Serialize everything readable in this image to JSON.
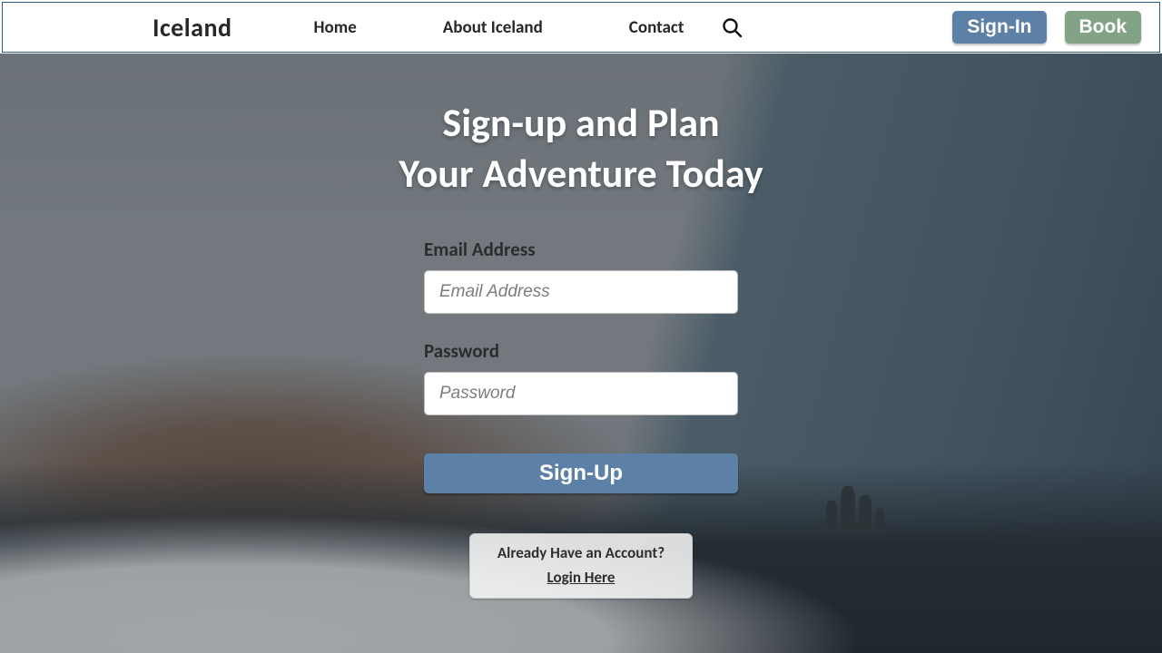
{
  "brand": "Iceland",
  "nav": {
    "home": "Home",
    "about": "About Iceland",
    "contact": "Contact"
  },
  "buttons": {
    "signin": "Sign-In",
    "book": "Book",
    "signup": "Sign-Up"
  },
  "headline_line1": "Sign-up and Plan",
  "headline_line2": "Your Adventure Today",
  "form": {
    "email_label": "Email Address",
    "email_placeholder": "Email Address",
    "password_label": "Password",
    "password_placeholder": "Password"
  },
  "login_prompt": {
    "question": "Already Have an Account?",
    "link": "Login Here"
  },
  "icons": {
    "search": "search-icon"
  },
  "colors": {
    "primary": "#5d80a7",
    "accent": "#83a387"
  }
}
